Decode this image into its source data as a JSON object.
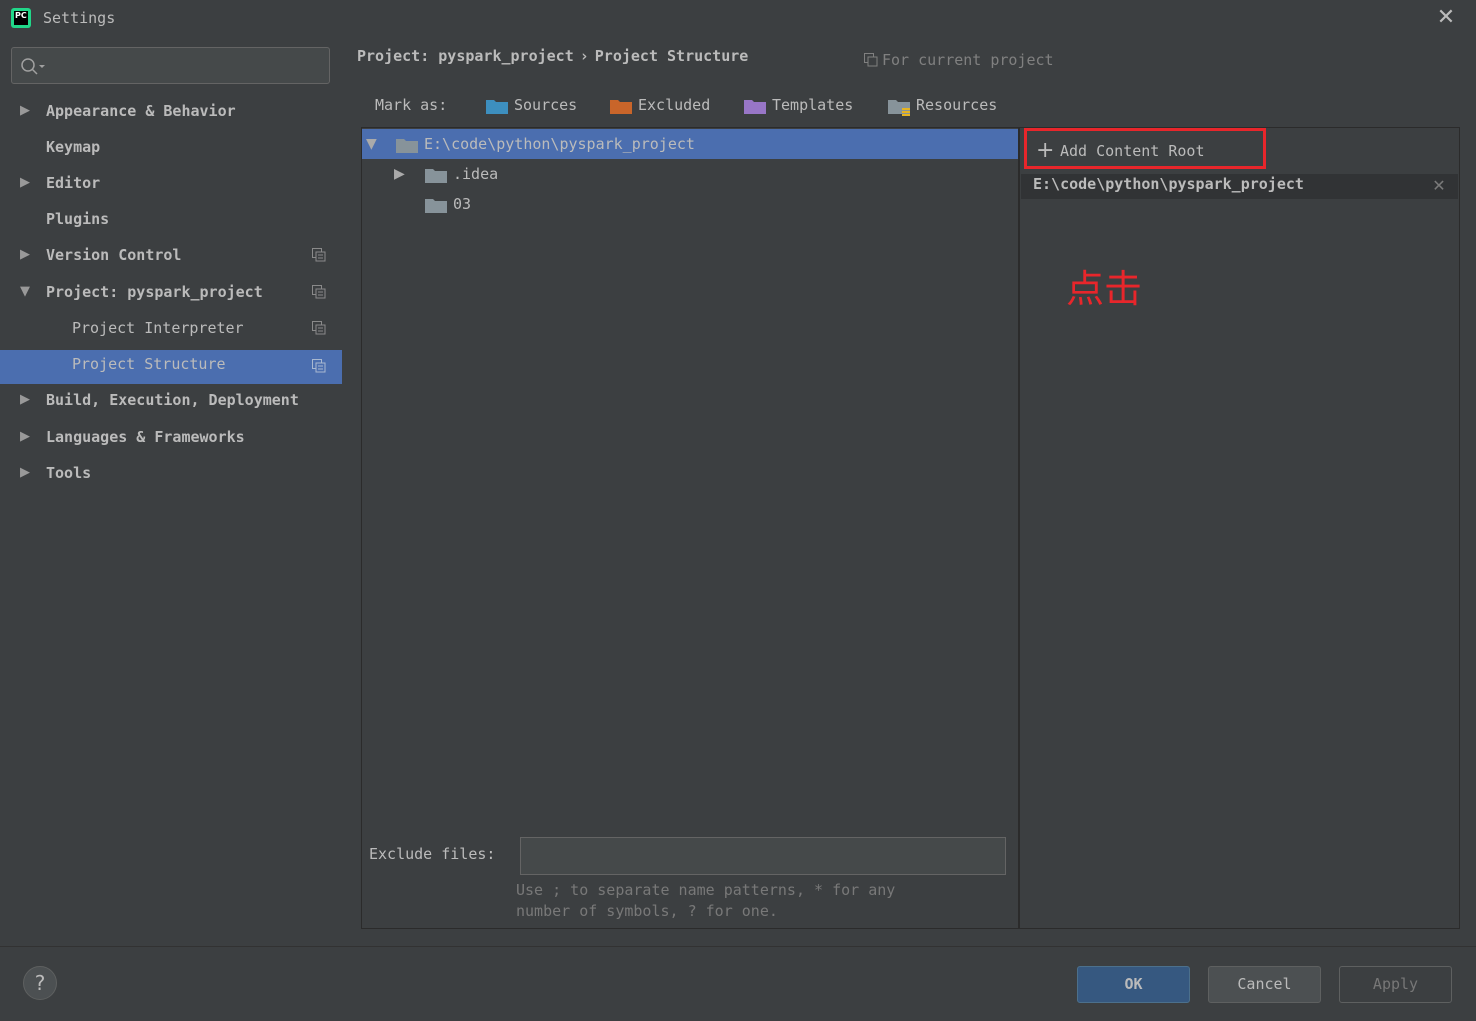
{
  "window": {
    "title": "Settings",
    "app_icon_text": "PC"
  },
  "sidebar": {
    "search_placeholder": "",
    "items": [
      {
        "label": "Appearance & Behavior",
        "expandable": true
      },
      {
        "label": "Keymap",
        "expandable": false
      },
      {
        "label": "Editor",
        "expandable": true
      },
      {
        "label": "Plugins",
        "expandable": false
      },
      {
        "label": "Version Control",
        "expandable": true
      },
      {
        "label": "Project: pyspark_project",
        "expandable": true,
        "expanded": true
      },
      {
        "label": "Project Interpreter",
        "sub": true
      },
      {
        "label": "Project Structure",
        "sub": true,
        "selected": true
      },
      {
        "label": "Build, Execution, Deployment",
        "expandable": true
      },
      {
        "label": "Languages & Frameworks",
        "expandable": true
      },
      {
        "label": "Tools",
        "expandable": true
      }
    ]
  },
  "breadcrumb": {
    "parent": "Project: pyspark_project",
    "separator": "›",
    "current": "Project Structure"
  },
  "scope_note": "For current project",
  "mark_as": {
    "label": "Mark as:",
    "buttons": [
      {
        "label": "Sources",
        "color": "#3d8fbf"
      },
      {
        "label": "Excluded",
        "color": "#c9652a"
      },
      {
        "label": "Templates",
        "color": "#9876c7"
      },
      {
        "label": "Resources",
        "color": "#87939a"
      }
    ]
  },
  "tree": {
    "root": "E:\\code\\python\\pyspark_project",
    "children": [
      ".idea",
      "03"
    ]
  },
  "content_roots": {
    "add_button": "Add Content Root",
    "entries": [
      "E:\\code\\python\\pyspark_project"
    ]
  },
  "annotation": "点击",
  "exclude": {
    "label": "Exclude files:",
    "value": "",
    "hint_line1": "Use ; to separate name patterns, * for any",
    "hint_line2": "number of symbols, ? for one."
  },
  "footer": {
    "help": "?",
    "ok": "OK",
    "cancel": "Cancel",
    "apply": "Apply"
  },
  "colors": {
    "background": "#3c3f41",
    "selection": "#4b6eaf",
    "highlight": "#e8262b",
    "folder": "#87939a"
  }
}
